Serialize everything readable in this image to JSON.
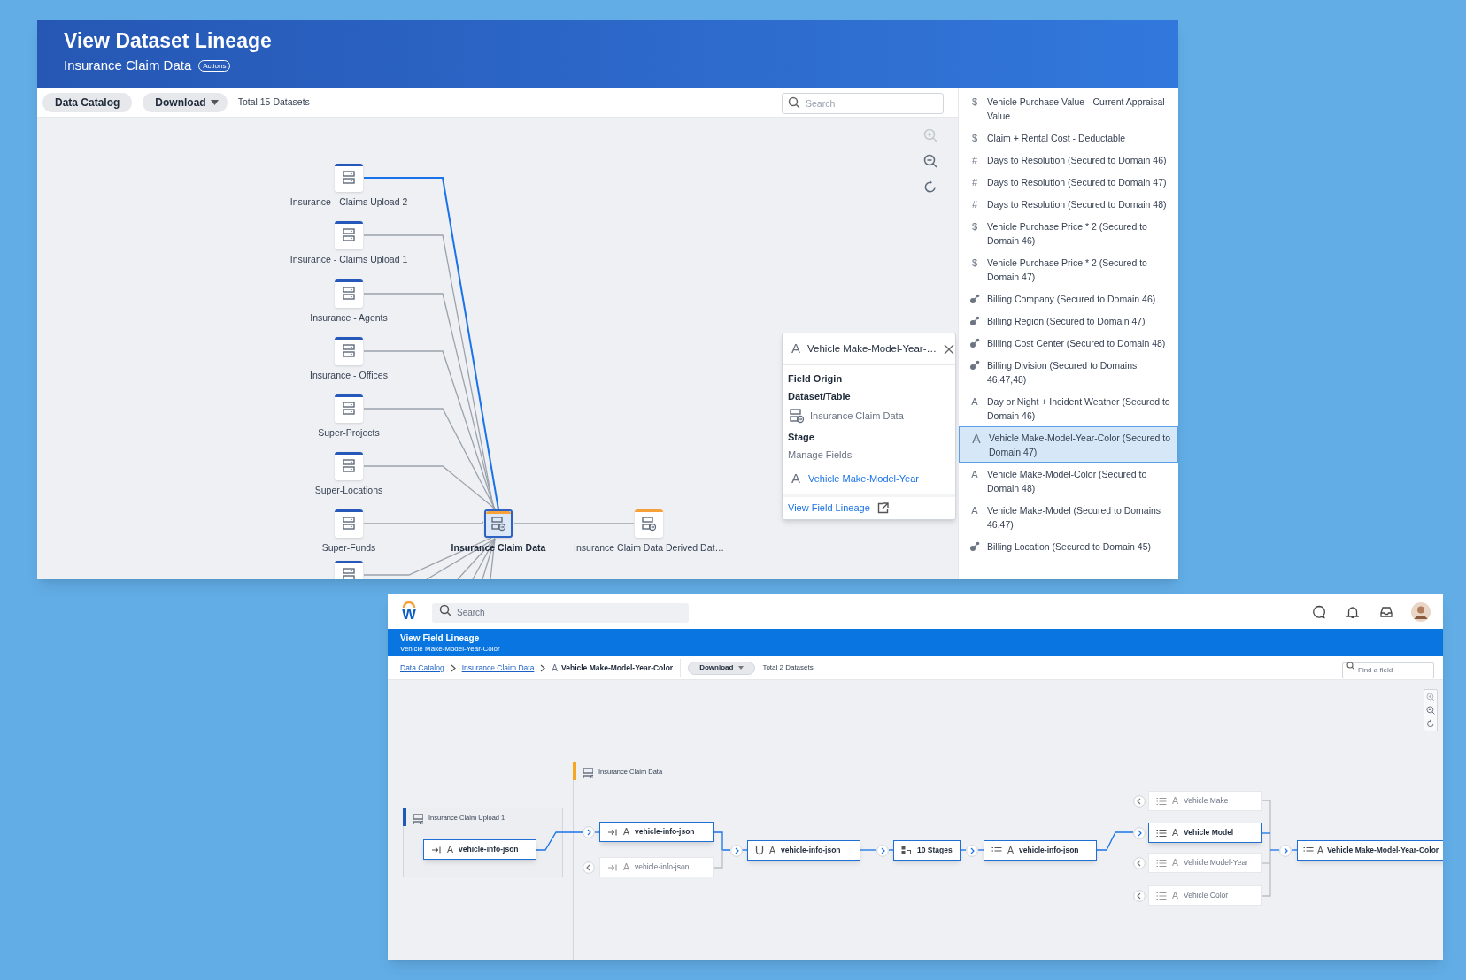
{
  "lineage_window": {
    "title": "View Dataset Lineage",
    "subtitle": "Insurance Claim Data",
    "actions_badge": "Actions",
    "toolbar": {
      "catalog_button": "Data Catalog",
      "download_button": "Download",
      "total": "Total 15 Datasets",
      "search": {
        "placeholder": "Search"
      }
    },
    "canvas": {
      "zoom_in_disabled": true
    },
    "sources": [
      {
        "label": "Insurance - Claims Upload 2",
        "selected": true
      },
      {
        "label": "Insurance - Claims Upload 1",
        "selected": false
      },
      {
        "label": "Insurance - Agents",
        "selected": false
      },
      {
        "label": "Insurance - Offices",
        "selected": false
      },
      {
        "label": "Super-Projects",
        "selected": false
      },
      {
        "label": "Super-Locations",
        "selected": false
      },
      {
        "label": "Super-Funds",
        "selected": false
      },
      {
        "selected": false
      }
    ],
    "center_dataset": {
      "label": "Insurance Claim Data"
    },
    "derived_dataset": {
      "label": "Insurance Claim Data Derived Dat…"
    },
    "field_popup": {
      "icon": "A",
      "title": "Vehicle Make-Model-Year-…",
      "heading": "Field Origin",
      "dataset_label": "Dataset/Table",
      "dataset": "Insurance Claim Data",
      "stage_label": "Stage",
      "stage": "Manage Fields",
      "field_icon": "A",
      "field_link": "Vehicle Make-Model-Year",
      "lineage_link": "View Field Lineage"
    },
    "fields": [
      {
        "kind": "currency",
        "icon": "$",
        "label": "Vehicle Purchase Value - Current Appraisal Value",
        "selected": false
      },
      {
        "kind": "currency",
        "icon": "$",
        "label": "Claim + Rental Cost - Deductable",
        "selected": false
      },
      {
        "kind": "number",
        "icon": "#",
        "label": "Days to Resolution (Secured to Domain 46)",
        "selected": false
      },
      {
        "kind": "number",
        "icon": "#",
        "label": "Days to Resolution (Secured to Domain 47)",
        "selected": false
      },
      {
        "kind": "number",
        "icon": "#",
        "label": "Days to Resolution (Secured to Domain 48)",
        "selected": false
      },
      {
        "kind": "currency",
        "icon": "$",
        "label": "Vehicle Purchase Price * 2 (Secured to Domain 46)",
        "selected": false
      },
      {
        "kind": "currency",
        "icon": "$",
        "label": "Vehicle Purchase Price * 2 (Secured to Domain 47)",
        "selected": false
      },
      {
        "kind": "reference",
        "label": "Billing Company (Secured to Domain 46)",
        "selected": false
      },
      {
        "kind": "reference",
        "label": "Billing Region (Secured to Domain 47)",
        "selected": false
      },
      {
        "kind": "reference",
        "label": "Billing Cost Center (Secured to Domain 48)",
        "selected": false
      },
      {
        "kind": "reference",
        "label": "Billing Division (Secured to Domains 46,47,48)",
        "selected": false
      },
      {
        "kind": "text",
        "icon": "A",
        "label": "Day or Night + Incident Weather (Secured to Domain 46)",
        "selected": false
      },
      {
        "kind": "text",
        "icon": "A",
        "label": "Vehicle Make-Model-Year-Color (Secured to Domain 47)",
        "selected": true
      },
      {
        "kind": "text",
        "icon": "A",
        "label": "Vehicle Make-Model-Color (Secured to Domain 48)",
        "selected": false
      },
      {
        "kind": "text",
        "icon": "A",
        "label": "Vehicle Make-Model (Secured to Domains 46,47)",
        "selected": false
      },
      {
        "kind": "reference",
        "label": "Billing Location (Secured to Domain 45)",
        "selected": false
      }
    ]
  },
  "field_lineage_window": {
    "logo": "W",
    "search": {
      "placeholder": "Search"
    },
    "title": "View Field Lineage",
    "subtitle": "Vehicle Make-Model-Year-Color",
    "breadcrumbs": [
      {
        "kind": "link",
        "label": "Data Catalog"
      },
      {
        "kind": "link",
        "label": "Insurance Claim Data"
      },
      {
        "kind": "current",
        "icon": "A",
        "label": "Vehicle Make-Model-Year-Color"
      }
    ],
    "download_button": "Download",
    "total": "Total 2 Datasets",
    "find_field": {
      "placeholder": "Find a field"
    },
    "groups": [
      {
        "label": "Insurance Claim Upload 1",
        "color": "#1e5bb8"
      },
      {
        "label": "Insurance Claim Data",
        "color": "#f5a623"
      }
    ],
    "nodes": [
      {
        "kind": "input",
        "type_icon": "A",
        "label": "vehicle-info-json",
        "selected": true
      },
      {
        "kind": "input",
        "type_icon": "A",
        "label": "vehicle-info-json",
        "selected": true,
        "expanded": true
      },
      {
        "kind": "input",
        "type_icon": "A",
        "label": "vehicle-info-json",
        "selected": false,
        "expanded": false
      },
      {
        "kind": "union",
        "type_icon": "A",
        "label": "vehicle-info-json",
        "selected": true,
        "expanded": true
      },
      {
        "kind": "stages",
        "label": "10 Stages",
        "selected": true,
        "expanded": true
      },
      {
        "kind": "list",
        "type_icon": "A",
        "label": "vehicle-info-json",
        "selected": true,
        "expanded": true
      },
      {
        "kind": "list",
        "type_icon": "A",
        "label": "Vehicle Make",
        "selected": false,
        "expanded": false
      },
      {
        "kind": "list",
        "type_icon": "A",
        "label": "Vehicle Model",
        "selected": true,
        "expanded": true
      },
      {
        "kind": "list",
        "type_icon": "A",
        "label": "Vehicle Model-Year",
        "selected": false,
        "expanded": false
      },
      {
        "kind": "list",
        "type_icon": "A",
        "label": "Vehicle Color",
        "selected": false,
        "expanded": false
      },
      {
        "kind": "list",
        "type_icon": "A",
        "label": "Vehicle Make-Model-Year-Color",
        "selected": true,
        "expanded": true
      }
    ]
  }
}
